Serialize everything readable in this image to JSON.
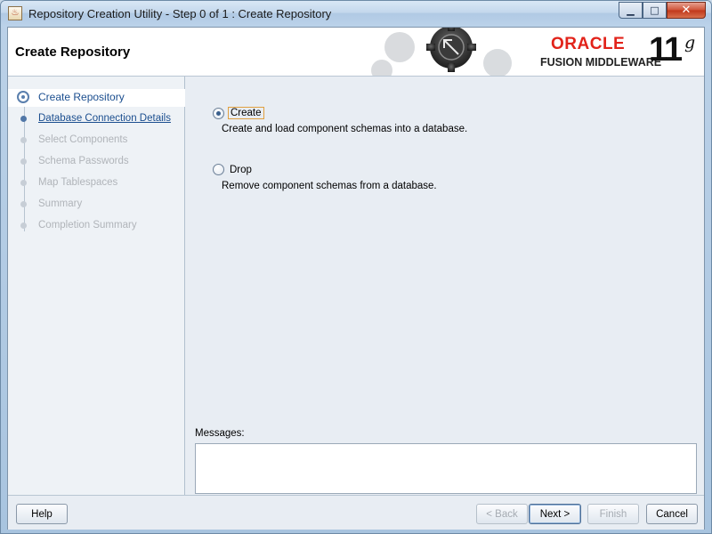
{
  "window": {
    "title": "Repository Creation Utility - Step 0 of 1 : Create Repository",
    "minimize_glyph": "▁",
    "maximize_glyph": "□",
    "close_glyph": "✕"
  },
  "header": {
    "title": "Create Repository",
    "logo": {
      "oracle": "ORACLE",
      "product": "FUSION MIDDLEWARE",
      "version": "11",
      "version_suffix": "g"
    }
  },
  "nav": {
    "items": [
      {
        "label": "Database Connection Details",
        "state": "link"
      },
      {
        "label": "Select Components",
        "state": "disabled"
      },
      {
        "label": "Schema Passwords",
        "state": "disabled"
      },
      {
        "label": "Map Tablespaces",
        "state": "disabled"
      },
      {
        "label": "Summary",
        "state": "disabled"
      },
      {
        "label": "Completion Summary",
        "state": "disabled"
      }
    ],
    "current": "Create Repository"
  },
  "options": {
    "create": {
      "label": "Create",
      "description": "Create and load component schemas into a database.",
      "selected": true
    },
    "drop": {
      "label": "Drop",
      "description": "Remove component schemas from a database.",
      "selected": false
    }
  },
  "messages": {
    "label": "Messages:",
    "value": ""
  },
  "buttons": {
    "help": "Help",
    "back": "< Back",
    "next": "Next >",
    "finish": "Finish",
    "cancel": "Cancel"
  },
  "colors": {
    "accent": "#1b4e8f",
    "oracle_red": "#e2231a",
    "close_button": "#c0361a"
  }
}
